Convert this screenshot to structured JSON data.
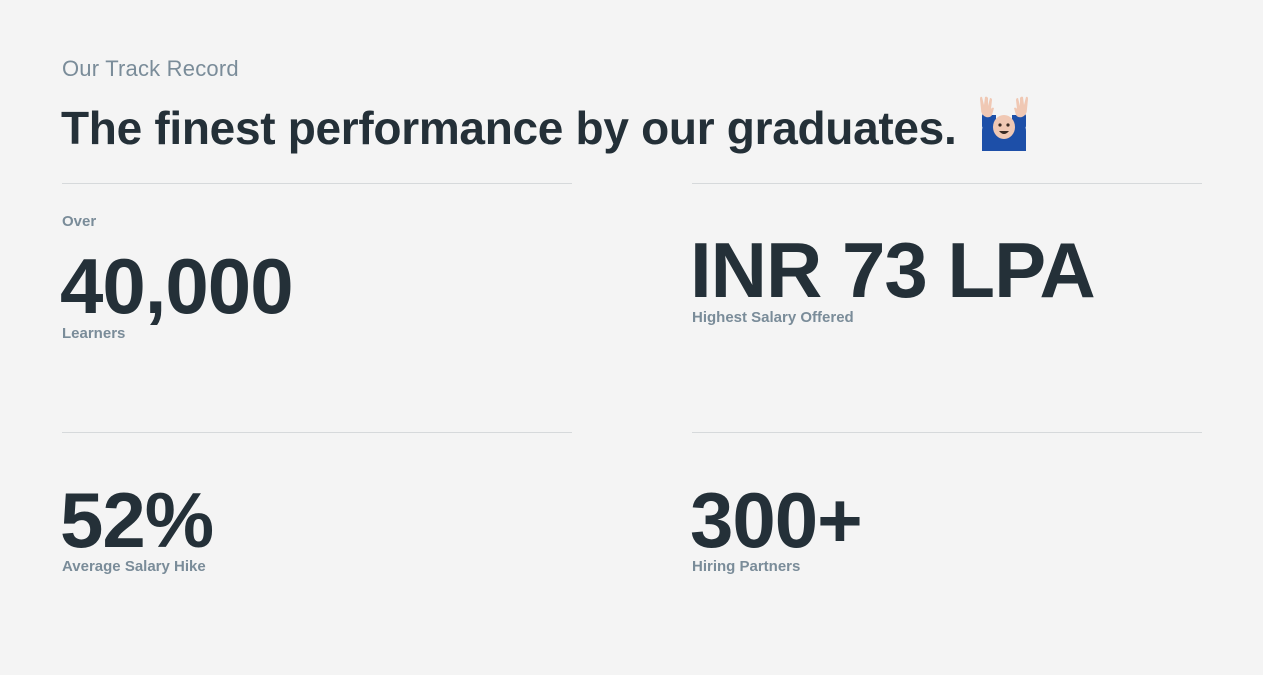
{
  "header": {
    "eyebrow": "Our Track Record",
    "headline": "The finest performance by our graduates."
  },
  "emoji": {
    "icon": "raising-hands-person-icon",
    "skin_color": "#f0c8b4",
    "shirt_color": "#1d4fa8"
  },
  "stats": [
    {
      "prefix": "Over",
      "value": "40,000",
      "caption": "Learners"
    },
    {
      "prefix": "",
      "value": "INR 73 LPA",
      "caption": "Highest Salary Offered"
    },
    {
      "prefix": "",
      "value": "52%",
      "caption": "Average Salary Hike"
    },
    {
      "prefix": "",
      "value": "300+",
      "caption": "Hiring Partners"
    }
  ],
  "colors": {
    "background": "#f4f4f4",
    "heading": "#243038",
    "muted": "#7a8c99",
    "divider": "#d6d9db"
  }
}
